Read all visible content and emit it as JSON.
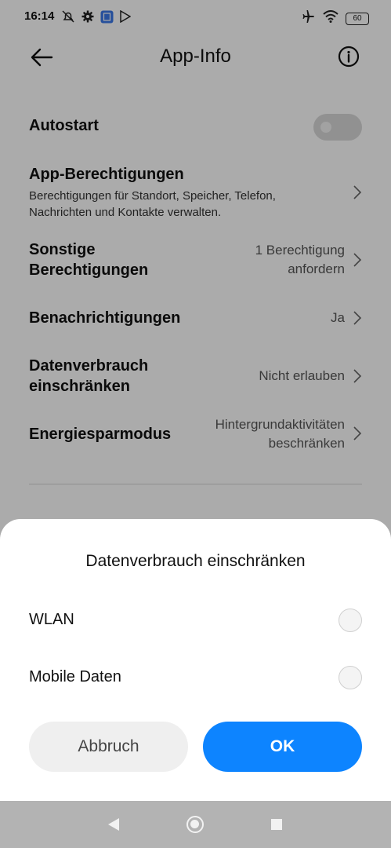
{
  "status_bar": {
    "time": "16:14",
    "battery": "60",
    "left_icons": [
      "silent-alarm-icon",
      "settings-gear-icon",
      "app-notification-icon",
      "play-store-icon"
    ],
    "right_icons": [
      "airplane-mode-icon",
      "wifi-icon",
      "battery-icon"
    ]
  },
  "header": {
    "title": "App-Info",
    "back_icon": "arrow-left-icon",
    "info_icon": "info-icon"
  },
  "settings": {
    "autostart": {
      "label": "Autostart",
      "enabled": false
    },
    "permissions": {
      "label": "App-Berechtigungen",
      "description_line1": "Berechtigungen für Standort, Speicher, Telefon,",
      "description_line2": "Nachrichten und Kontakte verwalten."
    },
    "other_permissions": {
      "label_line1": "Sonstige",
      "label_line2": "Berechtigungen",
      "value_line1": "1 Berechtigung",
      "value_line2": "anfordern"
    },
    "notifications": {
      "label": "Benachrichtigungen",
      "value": "Ja"
    },
    "data_usage": {
      "label_line1": "Datenverbrauch",
      "label_line2": "einschränken",
      "value": "Nicht erlauben"
    },
    "battery_saver": {
      "label": "Energiesparmodus",
      "value_line1": "Hintergrundaktivitäten",
      "value_line2": "beschränken"
    }
  },
  "dialog": {
    "title": "Datenverbrauch einschränken",
    "options": [
      {
        "label": "WLAN",
        "selected": false
      },
      {
        "label": "Mobile Daten",
        "selected": false
      }
    ],
    "cancel_label": "Abbruch",
    "ok_label": "OK"
  },
  "colors": {
    "accent": "#0d84ff",
    "dim_overlay": "#000000"
  }
}
